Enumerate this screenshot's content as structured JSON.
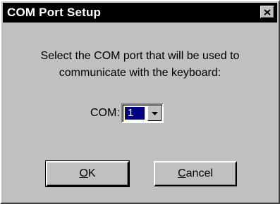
{
  "window": {
    "title": "COM Port Setup",
    "close_icon": "close-icon"
  },
  "prompt": {
    "line1": "Select the COM port that will be used to",
    "line2": "communicate with the keyboard:"
  },
  "com": {
    "label": "COM:",
    "selected_value": "1",
    "dropdown_icon": "chevron-down-icon"
  },
  "buttons": {
    "ok_mnemonic": "O",
    "ok_rest": "K",
    "cancel_mnemonic": "C",
    "cancel_rest": "ancel"
  },
  "colors": {
    "titlebar": "#000000",
    "face": "#c0c0c0",
    "selection": "#000080"
  }
}
